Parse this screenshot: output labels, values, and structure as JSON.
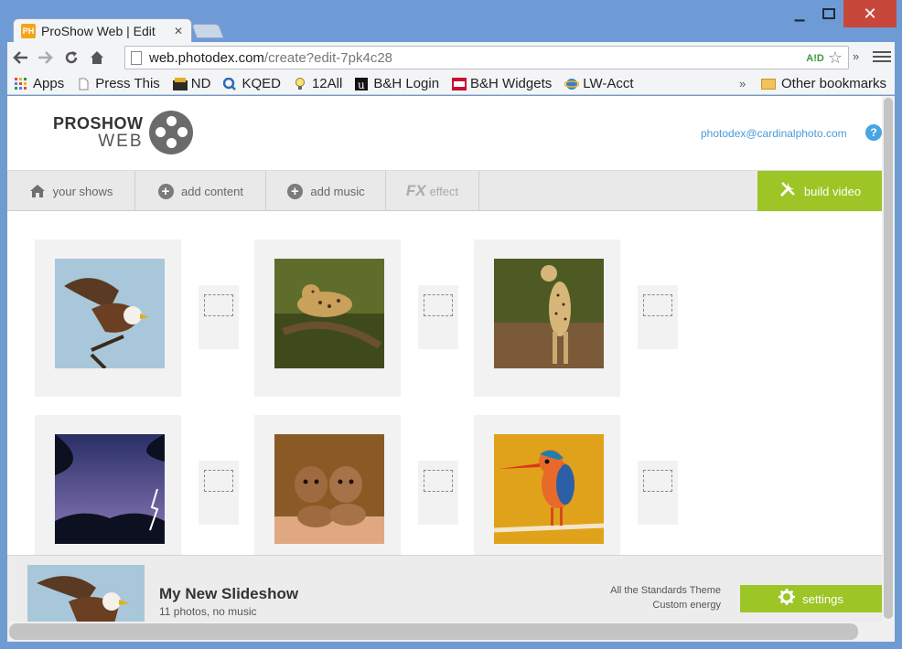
{
  "browser": {
    "tab_title": "ProShow Web | Edit",
    "tab_favicon_text": "PH",
    "url_host": "web.photodex.com",
    "url_path": "/create?edit-7pk4c28",
    "aid_label": "A!D",
    "bookmarks": [
      {
        "label": "Apps",
        "icon": "apps-grid-icon",
        "color": "#e2483a"
      },
      {
        "label": "Press This",
        "icon": "page-icon",
        "color": "#999999"
      },
      {
        "label": "ND",
        "icon": "nd-icon",
        "color": "#2b2b2b"
      },
      {
        "label": "KQED",
        "icon": "kqed-icon",
        "color": "#2b6cb0"
      },
      {
        "label": "12All",
        "icon": "bulb-icon",
        "color": "#d9a21b"
      },
      {
        "label": "B&H Login",
        "icon": "bh-u-icon",
        "color": "#111111"
      },
      {
        "label": "B&H Widgets",
        "icon": "bh-icon",
        "color": "#c8102e"
      },
      {
        "label": "LW-Acct",
        "icon": "ie-icon",
        "color": "#3a7dc9"
      }
    ],
    "more_chevron": "»",
    "other_bookmarks": "Other bookmarks"
  },
  "app": {
    "logo_top": "PROSHOW",
    "logo_bottom": "WEB",
    "user_email": "photodex@cardinalphoto.com",
    "help_label": "?",
    "nav": [
      {
        "label": "your shows",
        "icon": "home-icon"
      },
      {
        "label": "add content",
        "icon": "plus-circle-icon"
      },
      {
        "label": "add music",
        "icon": "plus-circle-icon"
      },
      {
        "label": "effect",
        "icon": "fx-icon",
        "prefix": "FX",
        "disabled": true
      }
    ],
    "build_label": "build video",
    "slides": [
      {
        "subject": "eagle"
      },
      {
        "subject": "leopard"
      },
      {
        "subject": "cheetah"
      },
      {
        "subject": "lightning"
      },
      {
        "subject": "hyena-cubs"
      },
      {
        "subject": "kingfisher"
      }
    ],
    "footer": {
      "title": "My New Slideshow",
      "subtitle": "11 photos, no music",
      "theme_line1": "All the Standards Theme",
      "theme_line2": "Custom energy",
      "settings_label": "settings"
    },
    "accent_color": "#9dc526",
    "link_color": "#4a9ad8"
  }
}
